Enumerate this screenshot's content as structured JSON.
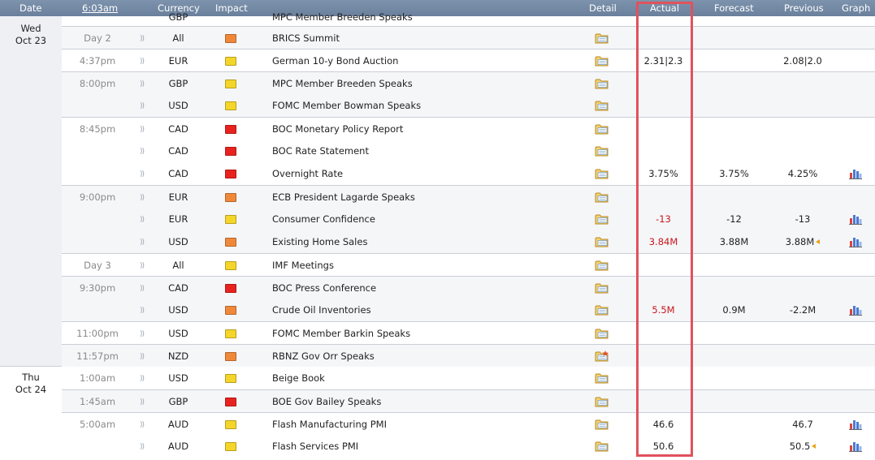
{
  "header": {
    "date": "Date",
    "time": "6:03am",
    "currency": "Currency",
    "impact": "Impact",
    "detail": "Detail",
    "actual": "Actual",
    "forecast": "Forecast",
    "previous": "Previous",
    "graph": "Graph"
  },
  "colors": {
    "impact_high": "#e8231f",
    "impact_medium": "#f0883a",
    "impact_low": "#f4d52a",
    "better": "#222222",
    "worse": "#c8161d",
    "highlight_box": "#e0525c"
  },
  "cut_row": {
    "currency": "GBP",
    "event": "MPC Member Breeden Speaks"
  },
  "days": [
    {
      "weekday": "Wed",
      "date": "Oct 23"
    },
    {
      "weekday": "Thu",
      "date": "Oct 24"
    }
  ],
  "rows": [
    {
      "time": "Day 2",
      "currency": "All",
      "impact": "medium",
      "event": "BRICS Summit",
      "detail_icon": "folder-icon",
      "actual": "",
      "actual_tone": "dark",
      "forecast": "",
      "previous": "",
      "revised": false,
      "graph": false
    },
    {
      "time": "4:37pm",
      "currency": "EUR",
      "impact": "low",
      "event": "German 10-y Bond Auction",
      "detail_icon": "folder-icon",
      "actual": "2.31|2.3",
      "actual_tone": "dark",
      "forecast": "",
      "previous": "2.08|2.0",
      "revised": false,
      "graph": false
    },
    {
      "time": "8:00pm",
      "currency": "GBP",
      "impact": "low",
      "event": "MPC Member Breeden Speaks",
      "detail_icon": "folder-icon",
      "actual": "",
      "actual_tone": "dark",
      "forecast": "",
      "previous": "",
      "revised": false,
      "graph": false
    },
    {
      "time": "",
      "currency": "USD",
      "impact": "low",
      "event": "FOMC Member Bowman Speaks",
      "detail_icon": "folder-icon",
      "actual": "",
      "actual_tone": "dark",
      "forecast": "",
      "previous": "",
      "revised": false,
      "graph": false
    },
    {
      "time": "8:45pm",
      "currency": "CAD",
      "impact": "high",
      "event": "BOC Monetary Policy Report",
      "detail_icon": "folder-icon",
      "actual": "",
      "actual_tone": "dark",
      "forecast": "",
      "previous": "",
      "revised": false,
      "graph": false
    },
    {
      "time": "",
      "currency": "CAD",
      "impact": "high",
      "event": "BOC Rate Statement",
      "detail_icon": "folder-icon",
      "actual": "",
      "actual_tone": "dark",
      "forecast": "",
      "previous": "",
      "revised": false,
      "graph": false
    },
    {
      "time": "",
      "currency": "CAD",
      "impact": "high",
      "event": "Overnight Rate",
      "detail_icon": "folder-icon",
      "actual": "3.75%",
      "actual_tone": "dark",
      "forecast": "3.75%",
      "previous": "4.25%",
      "revised": false,
      "graph": true
    },
    {
      "time": "9:00pm",
      "currency": "EUR",
      "impact": "medium",
      "event": "ECB President Lagarde Speaks",
      "detail_icon": "folder-icon",
      "actual": "",
      "actual_tone": "dark",
      "forecast": "",
      "previous": "",
      "revised": false,
      "graph": false
    },
    {
      "time": "",
      "currency": "EUR",
      "impact": "low",
      "event": "Consumer Confidence",
      "detail_icon": "folder-icon",
      "actual": "-13",
      "actual_tone": "red",
      "forecast": "-12",
      "previous": "-13",
      "revised": false,
      "graph": true
    },
    {
      "time": "",
      "currency": "USD",
      "impact": "medium",
      "event": "Existing Home Sales",
      "detail_icon": "folder-icon",
      "actual": "3.84M",
      "actual_tone": "red",
      "forecast": "3.88M",
      "previous": "3.88M",
      "revised": true,
      "graph": true
    },
    {
      "time": "Day 3",
      "currency": "All",
      "impact": "low",
      "event": "IMF Meetings",
      "detail_icon": "folder-icon",
      "actual": "",
      "actual_tone": "dark",
      "forecast": "",
      "previous": "",
      "revised": false,
      "graph": false
    },
    {
      "time": "9:30pm",
      "currency": "CAD",
      "impact": "high",
      "event": "BOC Press Conference",
      "detail_icon": "folder-icon",
      "actual": "",
      "actual_tone": "dark",
      "forecast": "",
      "previous": "",
      "revised": false,
      "graph": false
    },
    {
      "time": "",
      "currency": "USD",
      "impact": "medium",
      "event": "Crude Oil Inventories",
      "detail_icon": "folder-icon",
      "actual": "5.5M",
      "actual_tone": "red",
      "forecast": "0.9M",
      "previous": "-2.2M",
      "revised": false,
      "graph": true
    },
    {
      "time": "11:00pm",
      "currency": "USD",
      "impact": "low",
      "event": "FOMC Member Barkin Speaks",
      "detail_icon": "folder-icon",
      "actual": "",
      "actual_tone": "dark",
      "forecast": "",
      "previous": "",
      "revised": false,
      "graph": false
    },
    {
      "time": "11:57pm",
      "currency": "NZD",
      "impact": "medium",
      "event": "RBNZ Gov Orr Speaks",
      "detail_icon": "folder-star-icon",
      "actual": "",
      "actual_tone": "dark",
      "forecast": "",
      "previous": "",
      "revised": false,
      "graph": false
    },
    {
      "time": "1:00am",
      "currency": "USD",
      "impact": "low",
      "event": "Beige Book",
      "detail_icon": "folder-icon",
      "actual": "",
      "actual_tone": "dark",
      "forecast": "",
      "previous": "",
      "revised": false,
      "graph": false
    },
    {
      "time": "1:45am",
      "currency": "GBP",
      "impact": "high",
      "event": "BOE Gov Bailey Speaks",
      "detail_icon": "folder-icon",
      "actual": "",
      "actual_tone": "dark",
      "forecast": "",
      "previous": "",
      "revised": false,
      "graph": false
    },
    {
      "time": "5:00am",
      "currency": "AUD",
      "impact": "low",
      "event": "Flash Manufacturing PMI",
      "detail_icon": "folder-icon",
      "actual": "46.6",
      "actual_tone": "dark",
      "forecast": "",
      "previous": "46.7",
      "revised": false,
      "graph": true
    },
    {
      "time": "",
      "currency": "AUD",
      "impact": "low",
      "event": "Flash Services PMI",
      "detail_icon": "folder-icon",
      "actual": "50.6",
      "actual_tone": "dark",
      "forecast": "",
      "previous": "50.5",
      "revised": true,
      "graph": true
    }
  ]
}
